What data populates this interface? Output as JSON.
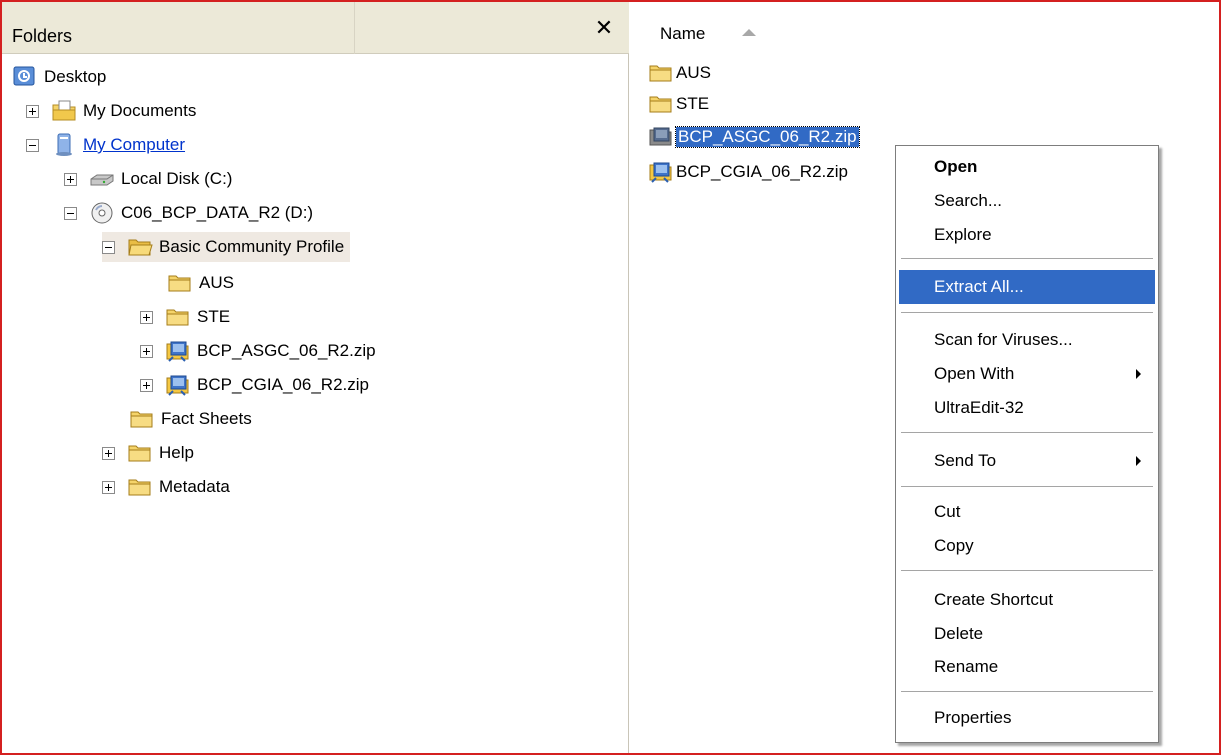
{
  "folders_pane": {
    "title": "Folders",
    "close_glyph": "✕",
    "tree": [
      {
        "label": "Desktop",
        "icon": "desktop-icon",
        "expander": "none"
      },
      {
        "label": "My Documents",
        "icon": "my-documents-icon",
        "expander": "plus"
      },
      {
        "label": "My Computer",
        "icon": "my-computer-icon",
        "expander": "minus"
      },
      {
        "label": "Local Disk (C:)",
        "icon": "hard-drive-icon",
        "expander": "plus"
      },
      {
        "label": "C06_BCP_DATA_R2 (D:)",
        "icon": "cd-drive-icon",
        "expander": "minus"
      },
      {
        "label": "Basic Community Profile",
        "icon": "folder-open-icon",
        "expander": "minus"
      },
      {
        "label": "AUS",
        "icon": "folder-icon",
        "expander": "none"
      },
      {
        "label": "STE",
        "icon": "folder-icon",
        "expander": "plus"
      },
      {
        "label": "BCP_ASGC_06_R2.zip",
        "icon": "zip-folder-icon",
        "expander": "plus"
      },
      {
        "label": "BCP_CGIA_06_R2.zip",
        "icon": "zip-folder-icon",
        "expander": "plus"
      },
      {
        "label": "Fact Sheets",
        "icon": "folder-icon",
        "expander": "none"
      },
      {
        "label": "Help",
        "icon": "folder-icon",
        "expander": "plus"
      },
      {
        "label": "Metadata",
        "icon": "folder-icon",
        "expander": "plus"
      }
    ]
  },
  "file_list": {
    "column_header": "Name",
    "sort": "ascending",
    "items": [
      {
        "label": "AUS",
        "icon": "folder-icon",
        "selected": false
      },
      {
        "label": "STE",
        "icon": "folder-icon",
        "selected": false
      },
      {
        "label": "BCP_ASGC_06_R2.zip",
        "icon": "zip-folder-icon",
        "selected": true
      },
      {
        "label": "BCP_CGIA_06_R2.zip",
        "icon": "zip-folder-icon",
        "selected": false
      }
    ]
  },
  "context_menu": {
    "items": [
      {
        "label": "Open",
        "bold": true
      },
      {
        "label": "Search..."
      },
      {
        "label": "Explore"
      },
      {
        "label": "Extract All...",
        "highlighted": true
      },
      {
        "label": "Scan for Viruses..."
      },
      {
        "label": "Open With",
        "submenu": true
      },
      {
        "label": "UltraEdit-32"
      },
      {
        "label": "Send To",
        "submenu": true
      },
      {
        "label": "Cut"
      },
      {
        "label": "Copy"
      },
      {
        "label": "Create Shortcut"
      },
      {
        "label": "Delete"
      },
      {
        "label": "Rename"
      },
      {
        "label": "Properties"
      }
    ]
  },
  "colors": {
    "selection": "#316ac5",
    "header_bg": "#ece9d8",
    "frame_border": "#d42020",
    "folder_yellow": "#f5d46a"
  }
}
